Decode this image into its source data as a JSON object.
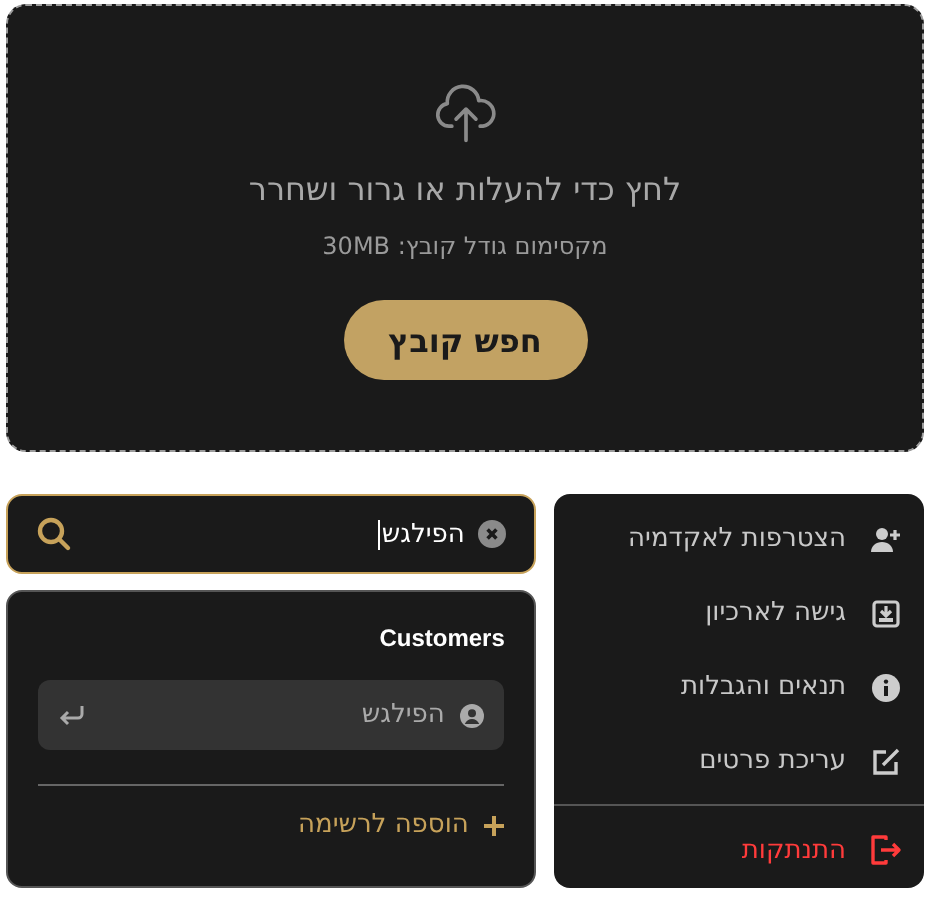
{
  "upload": {
    "title": "לחץ כדי להעלות או גרור ושחרר",
    "limit": "מקסימום גודל קובץ: 30MB",
    "button": "חפש קובץ"
  },
  "search": {
    "value": "הפילגש",
    "focused": true
  },
  "results": {
    "heading": "Customers",
    "items": [
      {
        "label": "הפילגש",
        "selected": true
      }
    ],
    "add": "הוספה לרשימה"
  },
  "menu": [
    {
      "label": "הצטרפות לאקדמיה",
      "kind": "normal"
    },
    {
      "label": "גישה לארכיון",
      "kind": "normal"
    },
    {
      "label": "תנאים והגבלות",
      "kind": "normal"
    },
    {
      "label": "עריכת פרטים",
      "kind": "normal"
    },
    {
      "label": "התנתקות",
      "kind": "danger"
    }
  ]
}
